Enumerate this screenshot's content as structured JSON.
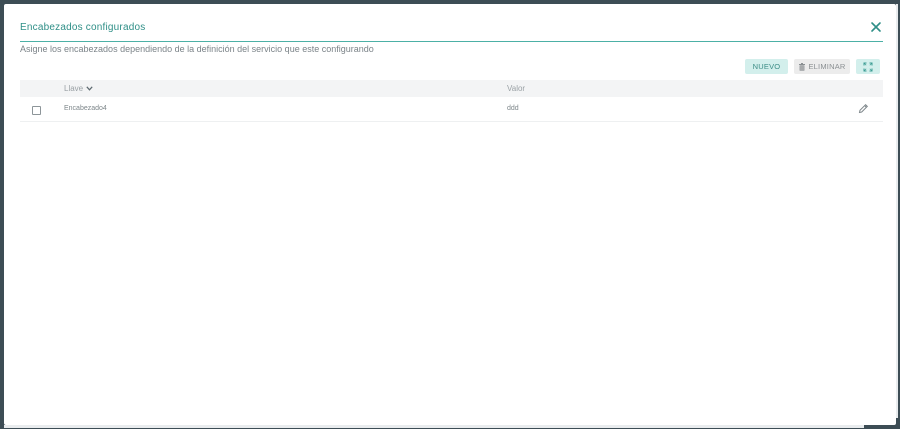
{
  "dialog": {
    "title": "Encabezados configurados",
    "subtitle": "Asigne los encabezados dependiendo de la definición del servicio que este configurando",
    "close_icon": "close-icon"
  },
  "toolbar": {
    "new_label": "NUEVO",
    "delete_label": "ELIMINAR",
    "delete_icon": "trash-icon",
    "expand_icon": "expand-icon"
  },
  "table": {
    "columns": [
      {
        "label": "Llave",
        "sort_icon": "chevron-down-icon"
      },
      {
        "label": "Valor"
      }
    ],
    "rows": [
      {
        "key": "Encabezado4",
        "value": "ddd",
        "checked": false,
        "edit_icon": "pencil-icon"
      }
    ]
  },
  "colors": {
    "accent": "#2f8f87",
    "accent_light": "#d3efec",
    "header_bg": "#f3f4f5"
  }
}
